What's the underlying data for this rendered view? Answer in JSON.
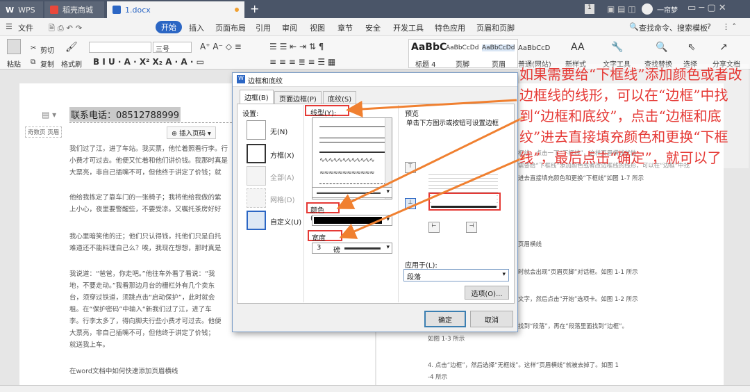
{
  "titlebar": {
    "tabs": [
      {
        "label": "WPS",
        "icon": "wps-logo-icon"
      },
      {
        "label": "稻壳商城",
        "icon": "docer-store-icon"
      },
      {
        "label": "1.docx",
        "icon": "word-doc-icon"
      }
    ],
    "new_tab": "+",
    "page_num": "1",
    "user_name": "一帘梦"
  },
  "menubar": {
    "file": "文件",
    "items": [
      "开始",
      "插入",
      "页面布局",
      "引用",
      "审阅",
      "视图",
      "章节",
      "安全",
      "开发工具",
      "特色应用",
      "页眉和页脚"
    ],
    "active": "开始",
    "search": "查找命令、搜索模板",
    "help": "?"
  },
  "ribbon": {
    "cut": "剪切",
    "paste": "粘贴",
    "copy": "复制",
    "format_painter": "格式刷",
    "font_size": "三号",
    "styles": [
      {
        "preview": "AaBbC",
        "name": "标题 4"
      },
      {
        "preview": "AaBbCcDd",
        "name": "页脚"
      },
      {
        "preview": "AaBbCcDd",
        "name": "页眉"
      },
      {
        "preview": "AaBbCcD",
        "name": "普通(网站)"
      }
    ],
    "new_style": "新样式",
    "text_tools": "文字工具",
    "find_replace": "查找替换",
    "select": "选择",
    "share": "分享文档"
  },
  "document": {
    "header_line": "联系电话：08512788999",
    "odd_header_tag": "奇数页 页眉",
    "insert_page_number": "插入页码",
    "left_paragraphs": [
      "我们过了江，进了车站。我买票，他忙着照看行李。行\n小费才可过去。他便又忙着和他们讲价钱。我那时真是\n大票亮，非自己插嘴不可，但他终于讲定了价钱；就",
      "他给我拣定了靠车门的一张椅子；我将他给我做的紫\n上小心，夜里要警醒些，不要受凉。又嘱托茶房好好",
      "我心里暗笑他的迂；他们只认得钱，托他们只是白托\n难道还不能料理自己么？唉，我现在想想，那时真是",
      "我说道：“爸爸，你走吧。”他往车外看了看说：“我\n地，不要走动。”我看那边月台的栅栏外有几个卖东\n台，须穿过铁道，须跳点击“启动保护”，此时就会\n租。在“保护密码”中输入“新我们过了江，进了车\n李。行李太多了，得向脚夫行些小费才可过去。他便\n大票亮，非自己插嘴不可，但他终于讲定了价钱；\n就送我上车。",
      "在word文档中如何快速添加页眉横线"
    ],
    "right_paragraphs": [
      "框线，点击一下“下框线”，这样页眉横线就做\n需要给“下框线”添加颜色或者改边框线的线形，可以在“边框”中找\n进去直接填充颜色和更换“下框线”如图 1-7 所示",
      "页眉横线",
      "时就会出现“页眉页脚”对话框。如图 1-1 所示",
      "文字，然后点击“开始”选项卡。如图 1-2 所示",
      "找到“段落”，再在“段落里面找到“边框”。",
      "如图 1-3 所示",
      "4. 点击“边框”，然后选择“无框线”。这样“页眉横线”就被去掉了。如图 1\n-4 所示"
    ]
  },
  "dialog": {
    "title": "边框和底纹",
    "tabs": [
      "边框(B)",
      "页面边框(P)",
      "底纹(S)"
    ],
    "setting_label": "设置:",
    "settings": [
      "无(N)",
      "方框(X)",
      "全部(A)",
      "网格(D)",
      "自定义(U)"
    ],
    "style_label": "线型(Y):",
    "color_label": "颜色(C):",
    "width_label": "宽度(W):",
    "width_value": "3",
    "width_unit": "磅",
    "preview_label": "预览",
    "preview_hint": "单击下方图示或按钮可设置边框",
    "apply_label": "应用于(L):",
    "apply_value": "段落",
    "options_button": "选项(O)...",
    "ok_button": "确定",
    "cancel_button": "取消"
  },
  "annotation": "如果需要给“下框线”添加颜色或者改边框线的线形，可以在“边框”中找到“边框和底纹”，点击“边框和底纹”进去直接填充颜色和更换“下框线”，最后点击“确定”，就可以了",
  "colors": {
    "annotation_red": "#e53935",
    "titlebar": "#4a5568",
    "accent_blue": "#2b66c4"
  }
}
